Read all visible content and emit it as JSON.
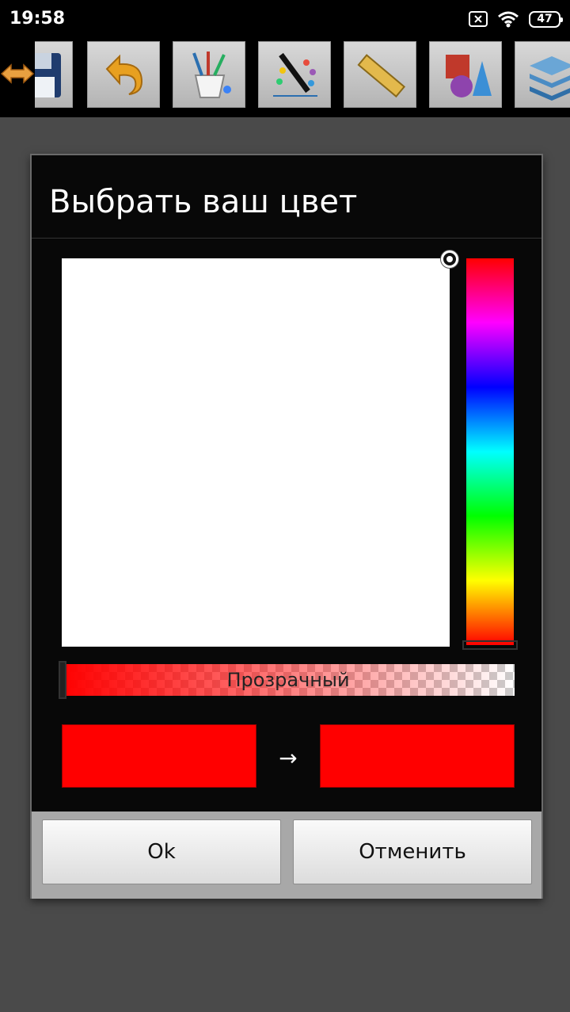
{
  "status_bar": {
    "time": "19:58",
    "battery": "47",
    "icons": [
      "sim-off-icon",
      "wifi-icon",
      "battery-icon"
    ]
  },
  "toolbar": {
    "tools": [
      {
        "icon": "resize-arrows-icon"
      },
      {
        "icon": "save-floppy-icon"
      },
      {
        "icon": "undo-icon"
      },
      {
        "icon": "brushes-cup-icon"
      },
      {
        "icon": "palette-pen-icon"
      },
      {
        "icon": "ruler-icon"
      },
      {
        "icon": "3d-shapes-icon"
      },
      {
        "icon": "layers-icon"
      }
    ]
  },
  "dialog": {
    "title": "Выбрать ваш цвет",
    "alpha_label": "Прозрачный",
    "arrow": "→",
    "old_color": "#ff0000",
    "new_color": "#ff0000",
    "buttons": {
      "ok": "Ok",
      "cancel": "Отменить"
    }
  },
  "colors": {
    "selected_hue": "#ff0000",
    "sv_area": "#ffffff"
  }
}
